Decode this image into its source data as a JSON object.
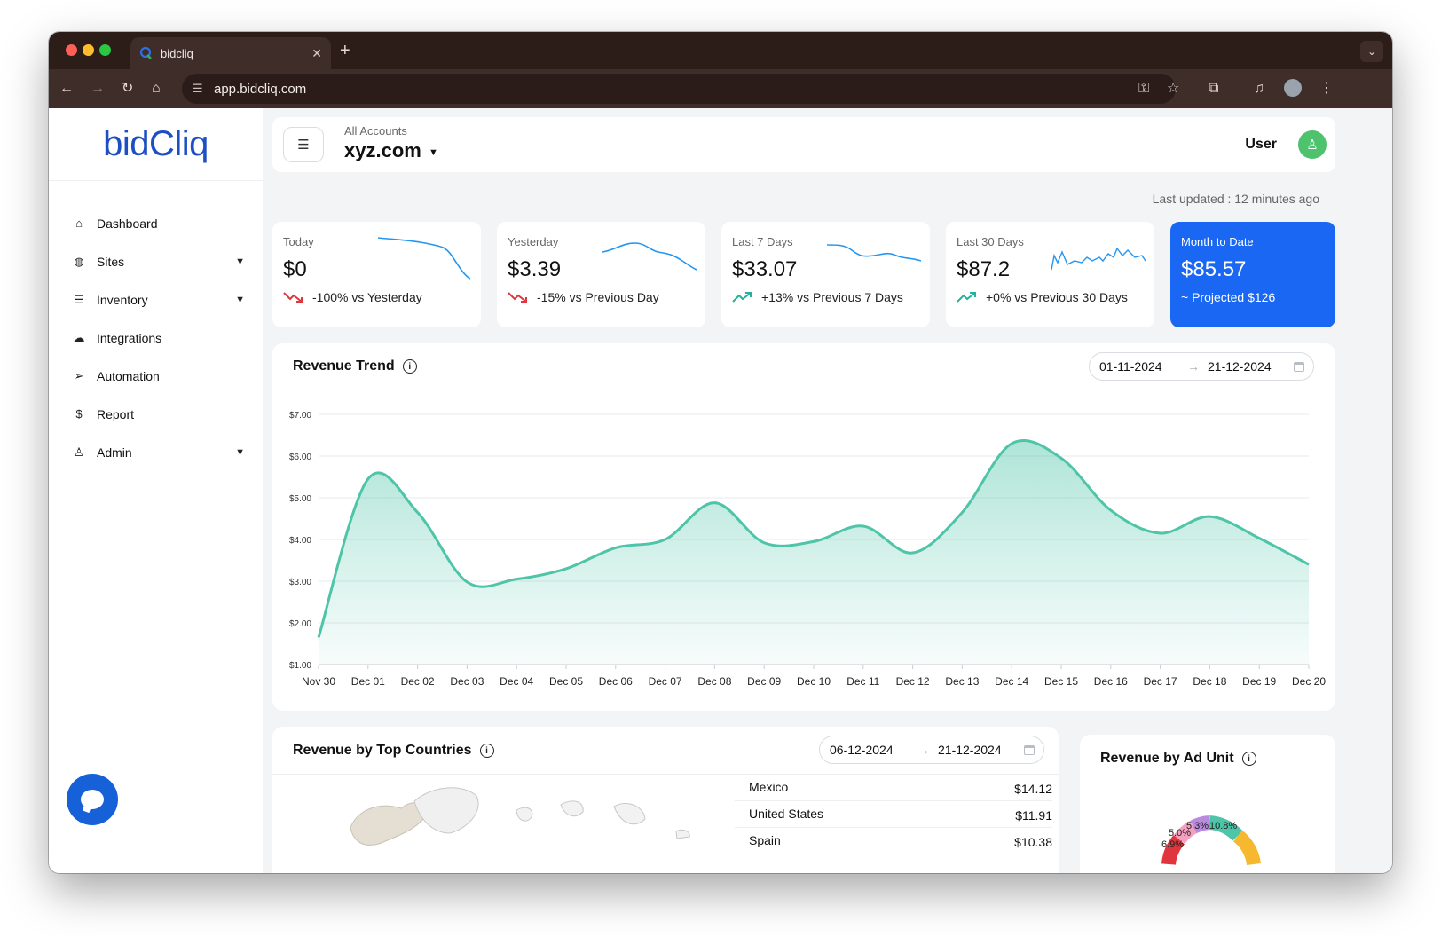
{
  "browser": {
    "tab_title": "bidcliq",
    "tab_close": "✕",
    "new_tab": "+",
    "url": "app.bidcliq.com"
  },
  "sidebar": {
    "logo_text": "bidCliq",
    "items": [
      {
        "label": "Dashboard",
        "icon": "home-icon",
        "has_children": false
      },
      {
        "label": "Sites",
        "icon": "globe-icon",
        "has_children": true
      },
      {
        "label": "Inventory",
        "icon": "list-icon",
        "has_children": true
      },
      {
        "label": "Integrations",
        "icon": "cloud-icon",
        "has_children": false
      },
      {
        "label": "Automation",
        "icon": "send-icon",
        "has_children": false
      },
      {
        "label": "Report",
        "icon": "dollar-circle-icon",
        "has_children": false
      },
      {
        "label": "Admin",
        "icon": "user-icon",
        "has_children": true
      }
    ]
  },
  "header": {
    "account_label": "All Accounts",
    "account_name": "xyz.com",
    "user_name": "User"
  },
  "last_updated": "Last updated : 12 minutes ago",
  "stats": [
    {
      "label": "Today",
      "value": "$0",
      "change": "-100% vs Yesterday",
      "trend": "down"
    },
    {
      "label": "Yesterday",
      "value": "$3.39",
      "change": "-15% vs Previous Day",
      "trend": "down"
    },
    {
      "label": "Last 7 Days",
      "value": "$33.07",
      "change": "+13% vs Previous 7 Days",
      "trend": "up"
    },
    {
      "label": "Last 30 Days",
      "value": "$87.2",
      "change": "+0% vs Previous 30 Days",
      "trend": "up"
    },
    {
      "label": "Month to Date",
      "value": "$85.57",
      "change": "~ Projected $126",
      "trend": "none"
    }
  ],
  "revenue_trend": {
    "title": "Revenue Trend",
    "date_from": "01-11-2024",
    "date_to": "21-12-2024"
  },
  "chart_data": {
    "type": "area",
    "title": "Revenue Trend",
    "categories": [
      "Nov 30",
      "Dec 01",
      "Dec 02",
      "Dec 03",
      "Dec 04",
      "Dec 05",
      "Dec 06",
      "Dec 07",
      "Dec 08",
      "Dec 09",
      "Dec 10",
      "Dec 11",
      "Dec 12",
      "Dec 13",
      "Dec 14",
      "Dec 15",
      "Dec 16",
      "Dec 17",
      "Dec 18",
      "Dec 19",
      "Dec 20"
    ],
    "values": [
      1.65,
      5.45,
      4.65,
      2.98,
      3.05,
      3.3,
      3.8,
      4.0,
      4.88,
      3.92,
      3.95,
      4.32,
      3.68,
      4.65,
      6.3,
      5.95,
      4.7,
      4.15,
      4.55,
      4.03,
      3.4
    ],
    "y_ticks": [
      "$1.00",
      "$2.00",
      "$3.00",
      "$4.00",
      "$5.00",
      "$6.00",
      "$7.00"
    ],
    "ylim": [
      1,
      7
    ],
    "color": "#4ec4a8",
    "grid": true
  },
  "countries": {
    "title": "Revenue by Top Countries",
    "date_from": "06-12-2024",
    "date_to": "21-12-2024",
    "rows": [
      {
        "name": "Mexico",
        "value": "$14.12"
      },
      {
        "name": "United States",
        "value": "$11.91"
      },
      {
        "name": "Spain",
        "value": "$10.38"
      }
    ]
  },
  "ad_unit": {
    "title": "Revenue by Ad Unit",
    "labels": [
      "5.3%",
      "10.8%",
      "5.0%",
      "6.9%"
    ]
  },
  "colors": {
    "brand": "#1d4fc4",
    "accent_blue": "#1967f2",
    "chart_teal": "#4ec4a8",
    "down_red": "#e0353c",
    "up_teal": "#22b39a"
  }
}
